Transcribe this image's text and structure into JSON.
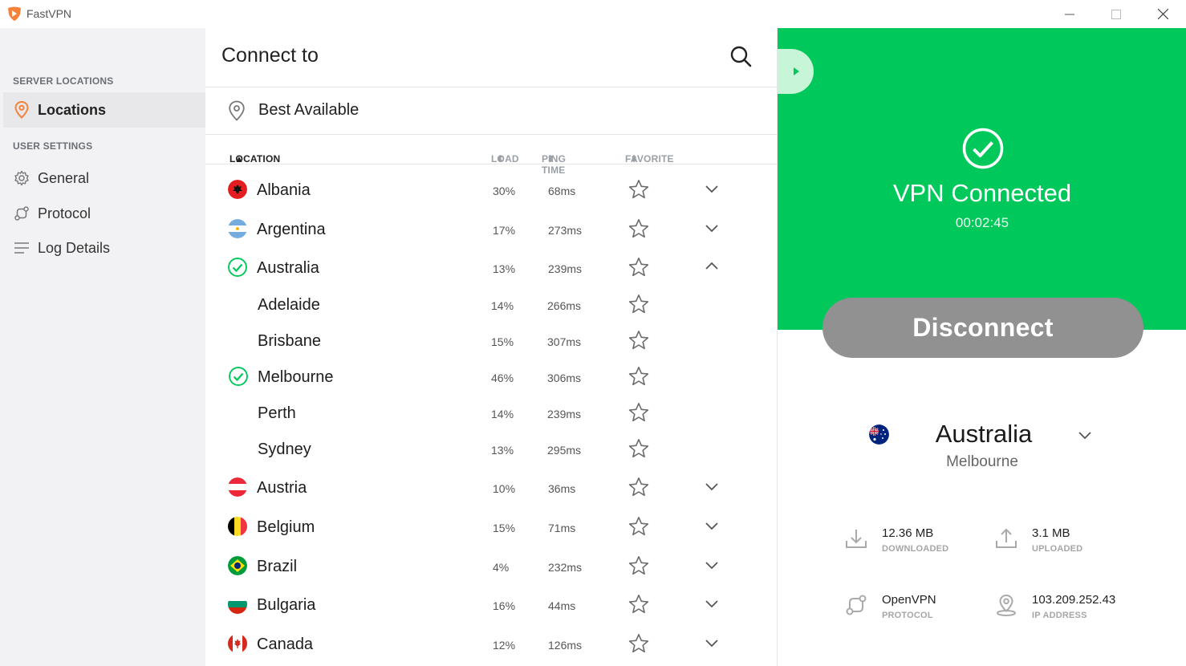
{
  "app": {
    "title": "FastVPN",
    "accent": "#f5823b",
    "brand_green": "#00c85a"
  },
  "sidebar": {
    "server_section": "SERVER LOCATIONS",
    "locations_label": "Locations",
    "user_section": "USER SETTINGS",
    "general_label": "General",
    "protocol_label": "Protocol",
    "log_label": "Log Details"
  },
  "connect": {
    "title": "Connect to",
    "best_available": "Best Available",
    "columns": {
      "location": "LOCATION",
      "load": "LOAD",
      "ping": "PING TIME",
      "favorite": "FAVORITE"
    },
    "rows": [
      {
        "name": "Albania",
        "load": "30%",
        "ping": "68ms",
        "flag": "albania",
        "expand": "chevron-down"
      },
      {
        "name": "Argentina",
        "load": "17%",
        "ping": "273ms",
        "flag": "argentina",
        "expand": "chevron-down"
      },
      {
        "name": "Australia",
        "load": "13%",
        "ping": "239ms",
        "flag": "check",
        "expand": "chevron-up"
      },
      {
        "name": "Adelaide",
        "load": "14%",
        "ping": "266ms",
        "flag": ""
      },
      {
        "name": "Brisbane",
        "load": "15%",
        "ping": "307ms",
        "flag": ""
      },
      {
        "name": "Melbourne",
        "load": "46%",
        "ping": "306ms",
        "flag": "check"
      },
      {
        "name": "Perth",
        "load": "14%",
        "ping": "239ms",
        "flag": ""
      },
      {
        "name": "Sydney",
        "load": "13%",
        "ping": "295ms",
        "flag": ""
      },
      {
        "name": "Austria",
        "load": "10%",
        "ping": "36ms",
        "flag": "austria",
        "expand": "chevron-down"
      },
      {
        "name": "Belgium",
        "load": "15%",
        "ping": "71ms",
        "flag": "belgium",
        "expand": "chevron-down"
      },
      {
        "name": "Brazil",
        "load": "4%",
        "ping": "232ms",
        "flag": "brazil",
        "expand": "chevron-down"
      },
      {
        "name": "Bulgaria",
        "load": "16%",
        "ping": "44ms",
        "flag": "bulgaria",
        "expand": "chevron-down"
      },
      {
        "name": "Canada",
        "load": "12%",
        "ping": "126ms",
        "flag": "canada",
        "expand": "chevron-down"
      }
    ]
  },
  "status": {
    "state": "VPN Connected",
    "timer": "00:02:45",
    "disconnect_label": "Disconnect",
    "country": "Australia",
    "city": "Melbourne",
    "downloaded": {
      "value": "12.36 MB",
      "label": "DOWNLOADED"
    },
    "uploaded": {
      "value": "3.1 MB",
      "label": "UPLOADED"
    },
    "protocol": {
      "value": "OpenVPN",
      "label": "PROTOCOL"
    },
    "ip": {
      "value": "103.209.252.43",
      "label": "IP ADDRESS"
    }
  }
}
